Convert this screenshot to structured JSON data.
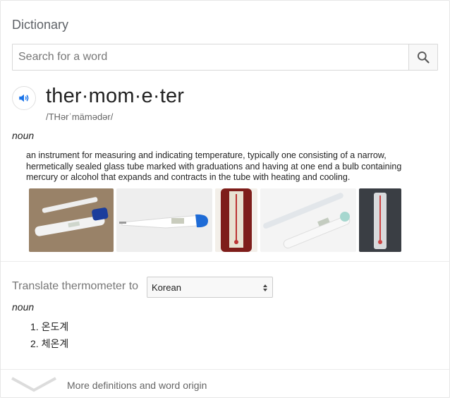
{
  "app": {
    "title": "Dictionary"
  },
  "search": {
    "placeholder": "Search for a word",
    "value": ""
  },
  "entry": {
    "word": "ther·mom·e·ter",
    "phonetic": "/THərˈmämədər/",
    "part_of_speech": "noun",
    "definition": "an instrument for measuring and indicating temperature, typically one consisting of a narrow, hermetically sealed glass tube marked with graduations and having at one end a bulb containing mercury or alcohol that expands and contracts in the tube with heating and cooling."
  },
  "icons": {
    "speaker": "speaker-icon",
    "search": "search-icon",
    "expand": "chevron-down-icon"
  },
  "images": [
    "digital-and-glass-thermometers-photo",
    "digital-thermometer-photo",
    "wooden-wall-thermometer-photo",
    "glass-and-digital-thermometer-photo",
    "wall-thermometer-photo"
  ],
  "translate": {
    "label": "Translate thermometer to",
    "language": "Korean",
    "part_of_speech": "noun",
    "items": [
      "1. 온도계",
      "2. 체온계"
    ]
  },
  "footer": {
    "more_label": "More definitions and word origin"
  },
  "colors": {
    "accent": "#1a73e8",
    "muted": "#5f6368"
  }
}
